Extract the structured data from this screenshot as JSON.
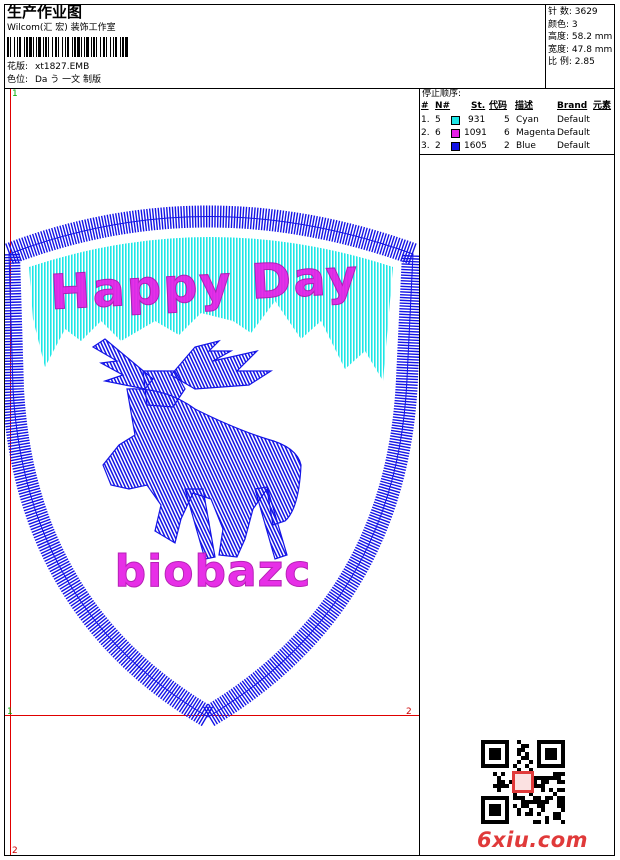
{
  "header": {
    "title": "生产作业图",
    "studio": "Wilcom(汇 宏) 装饰工作室",
    "pattern_label": "花版:",
    "pattern_value": "xt1827.EMB",
    "color_label": "色位:",
    "color_value": "Da う 一文  制版"
  },
  "stats": {
    "stitches": "针 数: 3629",
    "colors": "颜色: 3",
    "height": "高度: 58.2 mm",
    "width": "宽度: 47.8 mm",
    "scale": "比 例: 2.85"
  },
  "stop_sequence": {
    "title": "停止顺序:",
    "headers": [
      "#",
      "N#",
      "St.",
      "代码",
      "描述",
      "Brand",
      "元素"
    ],
    "rows": [
      {
        "idx": "1.",
        "n": "5",
        "st": "931",
        "code": "5",
        "desc": "Cyan",
        "brand": "Default",
        "color": "#1ee6e6"
      },
      {
        "idx": "2.",
        "n": "6",
        "st": "1091",
        "code": "6",
        "desc": "Magenta",
        "brand": "Default",
        "color": "#e61ee6"
      },
      {
        "idx": "3.",
        "n": "2",
        "st": "1605",
        "code": "2",
        "desc": "Blue",
        "brand": "Default",
        "color": "#1414e6"
      }
    ]
  },
  "design": {
    "top_text": "Happy Day",
    "bottom_text": "biobazc",
    "colors": {
      "cyan": "#1ee6e6",
      "magenta": "#e61ee6",
      "blue": "#1414e6",
      "guide": "#e00000"
    }
  },
  "markers": {
    "top_left": "1",
    "bottom_left": "2",
    "mid_left": "1",
    "mid_right": "2"
  },
  "watermark": "6xiu.com"
}
